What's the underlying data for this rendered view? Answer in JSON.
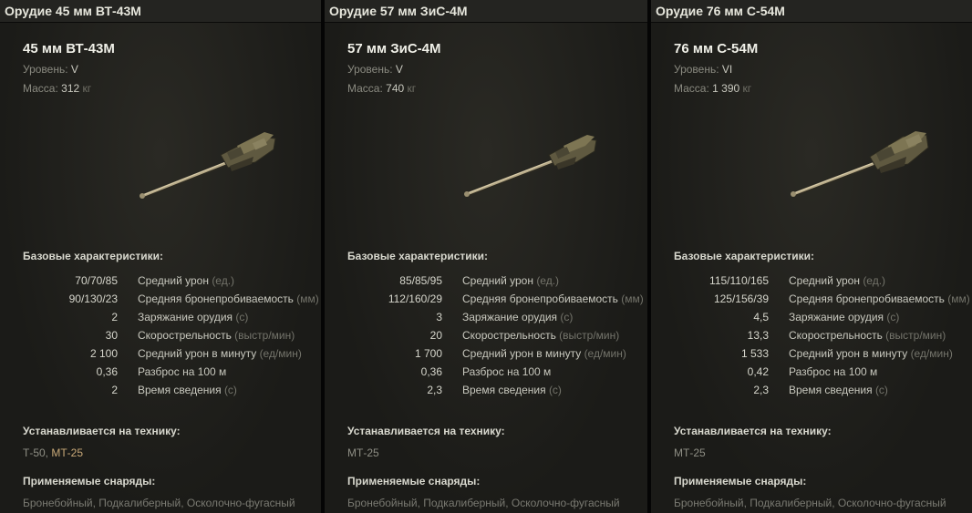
{
  "guns": [
    {
      "header": "Орудие 45 мм ВТ-43М",
      "name": "45 мм ВТ-43М",
      "level_label": "Уровень:",
      "level": "V",
      "mass_label": "Масса:",
      "mass": "312",
      "mass_unit": "кг",
      "base_title": "Базовые характеристики:",
      "stats": [
        {
          "value": "70/70/85",
          "label": "Средний урон",
          "unit": "(ед.)"
        },
        {
          "value": "90/130/23",
          "label": "Средняя бронепробиваемость",
          "unit": "(мм)"
        },
        {
          "value": "2",
          "label": "Заряжание орудия",
          "unit": "(с)"
        },
        {
          "value": "30",
          "label": "Скорострельность",
          "unit": "(выстр/мин)"
        },
        {
          "value": "2 100",
          "label": "Средний урон в минуту",
          "unit": "(ед/мин)"
        },
        {
          "value": "0,36",
          "label": "Разброс на 100 м",
          "unit": ""
        },
        {
          "value": "2",
          "label": "Время сведения",
          "unit": "(с)"
        }
      ],
      "install_title": "Устанавливается на технику:",
      "tech_plain": "Т-50,",
      "tech_hl": "МТ-25",
      "shells_title": "Применяемые снаряды:",
      "shells": "Бронебойный, Подкалиберный, Осколочно-фугасный"
    },
    {
      "header": "Орудие 57 мм ЗиС-4М",
      "name": "57 мм ЗиС-4М",
      "level_label": "Уровень:",
      "level": "V",
      "mass_label": "Масса:",
      "mass": "740",
      "mass_unit": "кг",
      "base_title": "Базовые характеристики:",
      "stats": [
        {
          "value": "85/85/95",
          "label": "Средний урон",
          "unit": "(ед.)"
        },
        {
          "value": "112/160/29",
          "label": "Средняя бронепробиваемость",
          "unit": "(мм)"
        },
        {
          "value": "3",
          "label": "Заряжание орудия",
          "unit": "(с)"
        },
        {
          "value": "20",
          "label": "Скорострельность",
          "unit": "(выстр/мин)"
        },
        {
          "value": "1 700",
          "label": "Средний урон в минуту",
          "unit": "(ед/мин)"
        },
        {
          "value": "0,36",
          "label": "Разброс на 100 м",
          "unit": ""
        },
        {
          "value": "2,3",
          "label": "Время сведения",
          "unit": "(с)"
        }
      ],
      "install_title": "Устанавливается на технику:",
      "tech_plain": "МТ-25",
      "tech_hl": "",
      "shells_title": "Применяемые снаряды:",
      "shells": "Бронебойный, Подкалиберный, Осколочно-фугасный"
    },
    {
      "header": "Орудие 76 мм С-54М",
      "name": "76 мм С-54М",
      "level_label": "Уровень:",
      "level": "VI",
      "mass_label": "Масса:",
      "mass": "1 390",
      "mass_unit": "кг",
      "base_title": "Базовые характеристики:",
      "stats": [
        {
          "value": "115/110/165",
          "label": "Средний урон",
          "unit": "(ед.)"
        },
        {
          "value": "125/156/39",
          "label": "Средняя бронепробиваемость",
          "unit": "(мм)"
        },
        {
          "value": "4,5",
          "label": "Заряжание орудия",
          "unit": "(с)"
        },
        {
          "value": "13,3",
          "label": "Скорострельность",
          "unit": "(выстр/мин)"
        },
        {
          "value": "1 533",
          "label": "Средний урон в минуту",
          "unit": "(ед/мин)"
        },
        {
          "value": "0,42",
          "label": "Разброс на 100 м",
          "unit": ""
        },
        {
          "value": "2,3",
          "label": "Время сведения",
          "unit": "(с)"
        }
      ],
      "install_title": "Устанавливается на технику:",
      "tech_plain": "МТ-25",
      "tech_hl": "",
      "shells_title": "Применяемые снаряды:",
      "shells": "Бронебойный, Подкалиберный, Осколочно-фугасный"
    }
  ]
}
